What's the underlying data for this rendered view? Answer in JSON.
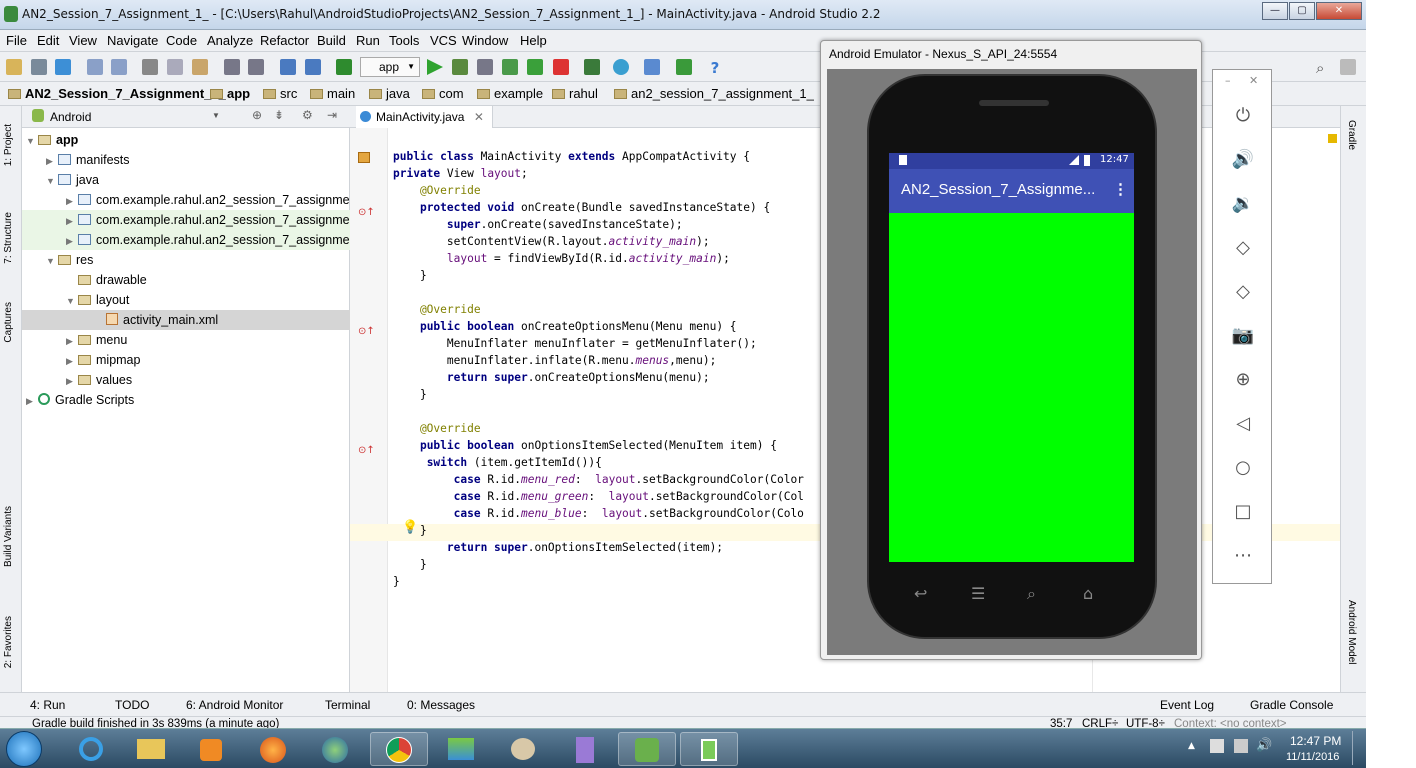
{
  "window": {
    "title": "AN2_Session_7_Assignment_1_ - [C:\\Users\\Rahul\\AndroidStudioProjects\\AN2_Session_7_Assignment_1_] - MainActivity.java - Android Studio 2.2",
    "min": "—",
    "max": "▢",
    "close": "✕"
  },
  "menu": [
    "File",
    "Edit",
    "View",
    "Navigate",
    "Code",
    "Analyze",
    "Refactor",
    "Build",
    "Run",
    "Tools",
    "VCS",
    "Window",
    "Help"
  ],
  "toolbar": {
    "config": "app"
  },
  "breadcrumb": [
    "AN2_Session_7_Assignment_1_",
    "app",
    "src",
    "main",
    "java",
    "com",
    "example",
    "rahul",
    "an2_session_7_assignment_1_"
  ],
  "project": {
    "view": "Android",
    "tree": [
      {
        "label": "app",
        "depth": 0,
        "arrow": "▼",
        "icon": "fld",
        "bold": true
      },
      {
        "label": "manifests",
        "depth": 1,
        "arrow": "▶",
        "icon": "pkg"
      },
      {
        "label": "java",
        "depth": 1,
        "arrow": "▼",
        "icon": "pkg"
      },
      {
        "label": "com.example.rahul.an2_session_7_assignment_",
        "depth": 2,
        "arrow": "▶",
        "icon": "pkg"
      },
      {
        "label": "com.example.rahul.an2_session_7_assignment_",
        "depth": 2,
        "arrow": "▶",
        "icon": "pkg",
        "hl": true
      },
      {
        "label": "com.example.rahul.an2_session_7_assignment_",
        "depth": 2,
        "arrow": "▶",
        "icon": "pkg",
        "hl": true
      },
      {
        "label": "res",
        "depth": 1,
        "arrow": "▼",
        "icon": "fld"
      },
      {
        "label": "drawable",
        "depth": 2,
        "arrow": "",
        "icon": "fld"
      },
      {
        "label": "layout",
        "depth": 2,
        "arrow": "▼",
        "icon": "fld"
      },
      {
        "label": "activity_main.xml",
        "depth": 3,
        "arrow": "",
        "icon": "xml",
        "sel": true
      },
      {
        "label": "menu",
        "depth": 2,
        "arrow": "▶",
        "icon": "fld"
      },
      {
        "label": "mipmap",
        "depth": 2,
        "arrow": "▶",
        "icon": "fld"
      },
      {
        "label": "values",
        "depth": 2,
        "arrow": "▶",
        "icon": "fld"
      },
      {
        "label": "Gradle Scripts",
        "depth": 0,
        "arrow": "▶",
        "icon": "gradle"
      }
    ]
  },
  "left_tabs": [
    "1: Project",
    "7: Structure",
    "Captures",
    "Build Variants",
    "2: Favorites"
  ],
  "right_tabs": [
    "Gradle",
    "Android Model"
  ],
  "editor": {
    "tab": "MainActivity.java",
    "lines": [
      "public class MainActivity extends AppCompatActivity {",
      "private View layout;",
      "    @Override",
      "    protected void onCreate(Bundle savedInstanceState) {",
      "        super.onCreate(savedInstanceState);",
      "        setContentView(R.layout.activity_main);",
      "        layout = findViewById(R.id.activity_main);",
      "    }",
      "",
      "    @Override",
      "    public boolean onCreateOptionsMenu(Menu menu) {",
      "        MenuInflater menuInflater = getMenuInflater();",
      "        menuInflater.inflate(R.menu.menus,menu);",
      "        return super.onCreateOptionsMenu(menu);",
      "    }",
      "",
      "    @Override",
      "    public boolean onOptionsItemSelected(MenuItem item) {",
      "     switch (item.getItemId()){",
      "         case R.id.menu_red:  layout.setBackgroundColor(Color",
      "         case R.id.menu_green:  layout.setBackgroundColor(Col",
      "         case R.id.menu_blue:  layout.setBackgroundColor(Colo",
      "    }",
      "        return super.onOptionsItemSelected(item);",
      "    }",
      "}"
    ]
  },
  "emulator": {
    "title": "Android Emulator - Nexus_S_API_24:5554",
    "time": "12:47",
    "app_title": "AN2_Session_7_Assignme...",
    "bg_color": "#00ff00",
    "side_controls": [
      "power-icon",
      "volume-up-icon",
      "volume-down-icon",
      "rotate-left-icon",
      "rotate-right-icon",
      "camera-icon",
      "zoom-icon",
      "back-icon",
      "home-icon",
      "overview-icon",
      "more-icon"
    ]
  },
  "bottom_tabs": [
    "4: Run",
    "TODO",
    "6: Android Monitor",
    "Terminal",
    "0: Messages",
    "Event Log",
    "Gradle Console"
  ],
  "status": {
    "message": "Gradle build finished in 3s 839ms (a minute ago)",
    "position": "35:7",
    "line_sep": "CRLF÷",
    "encoding": "UTF-8÷",
    "context": "Context: <no context>"
  },
  "taskbar": {
    "time": "12:47 PM",
    "date": "11/11/2016"
  }
}
